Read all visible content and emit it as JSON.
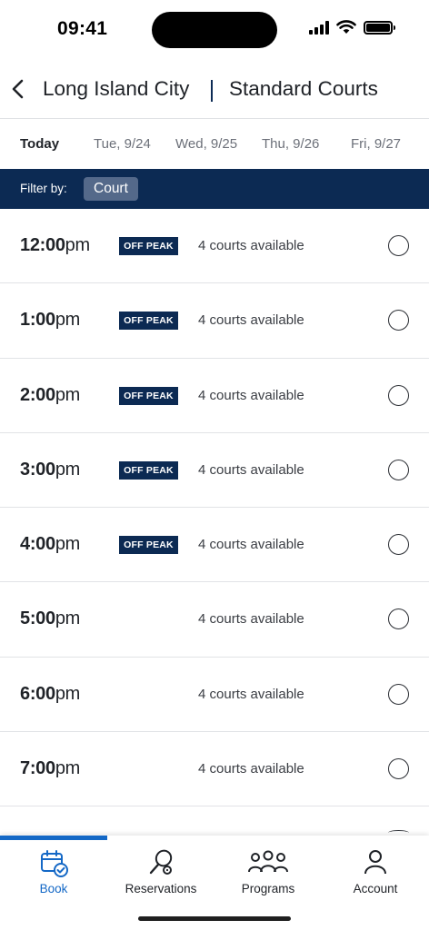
{
  "status_bar": {
    "time": "09:41"
  },
  "header": {
    "location": "Long Island City",
    "court_type": "Standard Courts"
  },
  "date_tabs": [
    {
      "label": "Today",
      "active": true
    },
    {
      "label": "Tue, 9/24",
      "active": false
    },
    {
      "label": "Wed, 9/25",
      "active": false
    },
    {
      "label": "Thu, 9/26",
      "active": false
    },
    {
      "label": "Fri, 9/27",
      "active": false
    }
  ],
  "filter": {
    "label": "Filter by:",
    "chip": "Court"
  },
  "slots": [
    {
      "time": "12:00",
      "ampm": "pm",
      "badge": "OFF PEAK",
      "availability": "4 courts available"
    },
    {
      "time": "1:00",
      "ampm": "pm",
      "badge": "OFF PEAK",
      "availability": "4 courts available"
    },
    {
      "time": "2:00",
      "ampm": "pm",
      "badge": "OFF PEAK",
      "availability": "4 courts available"
    },
    {
      "time": "3:00",
      "ampm": "pm",
      "badge": "OFF PEAK",
      "availability": "4 courts available"
    },
    {
      "time": "4:00",
      "ampm": "pm",
      "badge": "OFF PEAK",
      "availability": "4 courts available"
    },
    {
      "time": "5:00",
      "ampm": "pm",
      "badge": "",
      "availability": "4 courts available"
    },
    {
      "time": "6:00",
      "ampm": "pm",
      "badge": "",
      "availability": "4 courts available"
    },
    {
      "time": "7:00",
      "ampm": "pm",
      "badge": "",
      "availability": "4 courts available"
    }
  ],
  "tab_bar": {
    "book": "Book",
    "reservations": "Reservations",
    "programs": "Programs",
    "account": "Account"
  },
  "colors": {
    "navy": "#0c2a53",
    "accent": "#1468c6",
    "chip": "#54698a"
  }
}
